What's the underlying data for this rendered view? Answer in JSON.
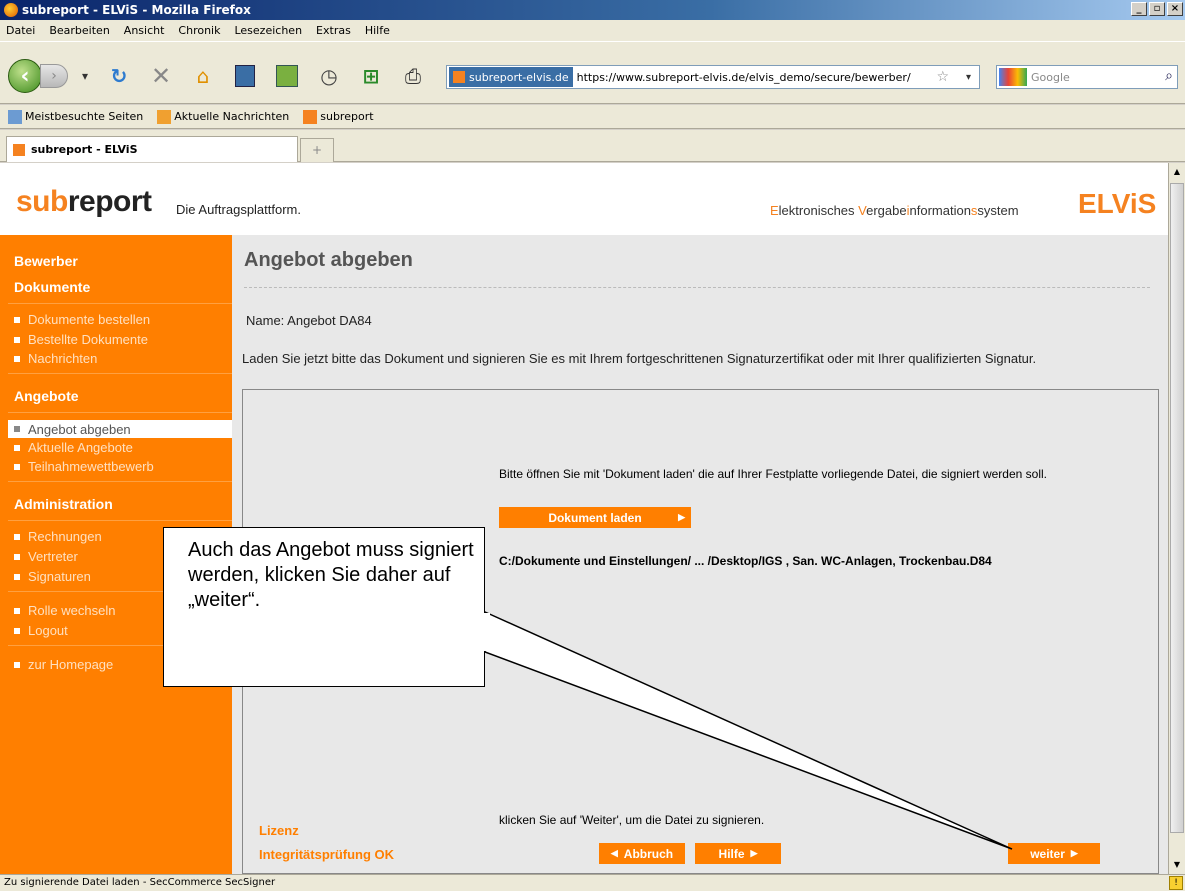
{
  "window": {
    "title": "subreport - ELViS - Mozilla Firefox"
  },
  "menu": [
    "Datei",
    "Bearbeiten",
    "Ansicht",
    "Chronik",
    "Lesezeichen",
    "Extras",
    "Hilfe"
  ],
  "navbar": {
    "site_identity": "subreport-elvis.de",
    "url": "https://www.subreport-elvis.de/elvis_demo/secure/bewerber/",
    "search_placeholder": "Google"
  },
  "bookmarks": [
    "Meistbesuchte Seiten",
    "Aktuelle Nachrichten",
    "subreport"
  ],
  "tabs": {
    "active": "subreport - ELViS"
  },
  "status": "Zu signierende Datei laden - SecCommerce SecSigner",
  "header": {
    "logo_sub": "sub",
    "logo_report": "report",
    "tagline": "Die Auftragsplattform.",
    "system_name_parts": [
      "E",
      "lektronisches ",
      "V",
      "ergabe",
      "i",
      "nformation",
      "s",
      "system"
    ],
    "elvis_logo": "ELViS"
  },
  "sidebar": {
    "role": "Bewerber",
    "sections": [
      {
        "title": "Dokumente",
        "items": [
          "Dokumente bestellen",
          "Bestellte Dokumente",
          "Nachrichten"
        ]
      },
      {
        "title": "Angebote",
        "items": [
          "Angebot abgeben",
          "Aktuelle Angebote",
          "Teilnahmewettbewerb"
        ],
        "active": "Angebot abgeben"
      },
      {
        "title": "Administration",
        "items": [
          "Rechnungen",
          "Vertreter",
          "Signaturen"
        ]
      }
    ],
    "extra": [
      "Rolle wechseln",
      "Logout",
      "zur Homepage"
    ]
  },
  "main": {
    "title": "Angebot abgeben",
    "name_line": "Name: Angebot DA84",
    "instruction": "Laden Sie jetzt bitte das Dokument und signieren Sie es mit Ihrem fortgeschrittenen Signaturzertifikat oder mit Ihrer qualifizierten Signatur.",
    "applet": {
      "instruction": "Bitte öffnen Sie mit 'Dokument laden' die auf Ihrer Festplatte vorliegende Datei, die signiert werden soll.",
      "load_button": "Dokument laden",
      "file_path": "C:/Dokumente und Einstellungen/ ... /Desktop/IGS , San. WC-Anlagen, Trockenbau.D84",
      "next_hint": "klicken Sie auf 'Weiter', um die Datei zu signieren.",
      "license": "Lizenz",
      "integrity": "Integritätsprüfung OK",
      "cancel_button": "Abbruch",
      "help_button": "Hilfe",
      "next_button": "weiter"
    }
  },
  "callout": {
    "text": "Auch das Angebot muss signiert werden, klicken Sie daher auf „weiter“."
  },
  "colors": {
    "accent": "#ff7f00",
    "titlebar": "#0a246a"
  }
}
